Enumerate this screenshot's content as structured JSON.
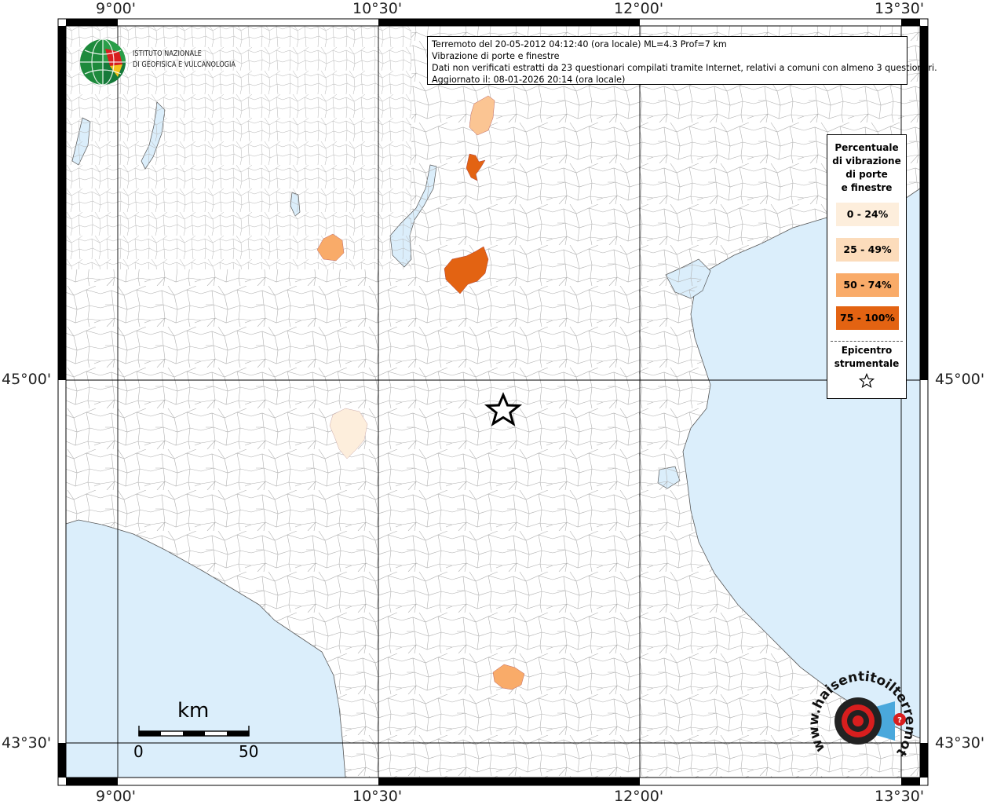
{
  "map": {
    "info_lines": [
      "Terremoto del 20-05-2012 04:12:40 (ora locale) ML=4.3 Prof=7 km",
      "Vibrazione di porte e finestre",
      "Dati non verificati estratti da 23 questionari compilati tramite Internet, relativi a comuni con almeno 3 questionari.",
      "Aggiornato il: 08-01-2026 20:14 (ora locale)"
    ],
    "longitude_labels": [
      "9°00'",
      "10°30'",
      "12°00'",
      "13°30'"
    ],
    "latitude_labels": [
      "45°00'",
      "43°30'"
    ],
    "sea_color": "#dbeefb",
    "land_color": "#ffffff",
    "boundary_color": "#aaaaaa",
    "frame_color": "#000000"
  },
  "logo": {
    "line1": "ISTITUTO NAZIONALE",
    "line2": "DI GEOFISICA E VULCANOLOGIA",
    "icon": "globe-icon"
  },
  "legend": {
    "title": [
      "Percentuale",
      "di vibrazione",
      "di porte",
      "e finestre"
    ],
    "classes": [
      {
        "label": "0 - 24%",
        "color": "#fdeedc"
      },
      {
        "label": "25 - 49%",
        "color": "#fcdcbb"
      },
      {
        "label": "50 - 74%",
        "color": "#f9ab69"
      },
      {
        "label": "75 - 100%",
        "color": "#e36312"
      }
    ],
    "epicenter_title": [
      "Epicentro",
      "strumentale"
    ],
    "epicenter_icon": "star-icon"
  },
  "scale_bar": {
    "unit": "km",
    "start": "0",
    "end": "50"
  },
  "watermark": {
    "text": "www.haisentitoilterremoto.it",
    "icon": "target-icon"
  }
}
